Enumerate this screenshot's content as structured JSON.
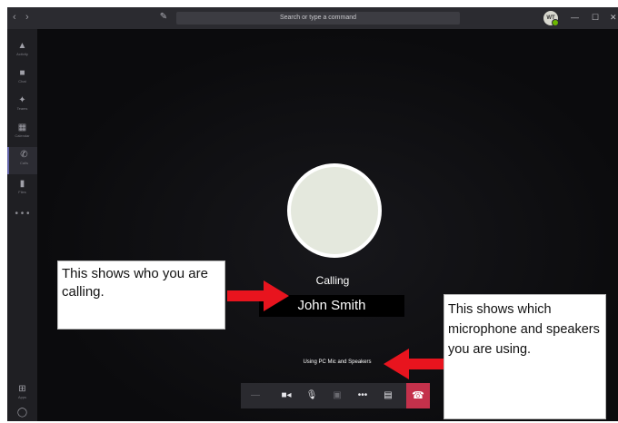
{
  "titlebar": {
    "back": "‹",
    "forward": "›",
    "search_placeholder": "Search or type a command",
    "user_initials": "WT",
    "minimize": "—",
    "maximize": "☐",
    "close": "✕"
  },
  "rail": {
    "items": [
      {
        "label": "Activity",
        "icon": "bell-icon"
      },
      {
        "label": "Chat",
        "icon": "chat-icon"
      },
      {
        "label": "Teams",
        "icon": "teams-icon"
      },
      {
        "label": "Calendar",
        "icon": "calendar-icon"
      },
      {
        "label": "Calls",
        "icon": "phone-icon",
        "active": true
      },
      {
        "label": "Files",
        "icon": "file-icon"
      }
    ],
    "more": "• • •",
    "bottom": [
      {
        "label": "Apps",
        "icon": "apps-icon"
      },
      {
        "label": "Help",
        "icon": "help-icon"
      }
    ]
  },
  "call": {
    "status": "Calling",
    "callee": "John Smith",
    "device": "Using PC Mic and Speakers"
  },
  "annotations": {
    "who": "This shows who you are calling.",
    "device": "This shows which microphone and speakers you are using."
  },
  "colors": {
    "hangup": "#c4314b",
    "annotation_arrow": "#e8141e",
    "accent": "#6264a7"
  }
}
